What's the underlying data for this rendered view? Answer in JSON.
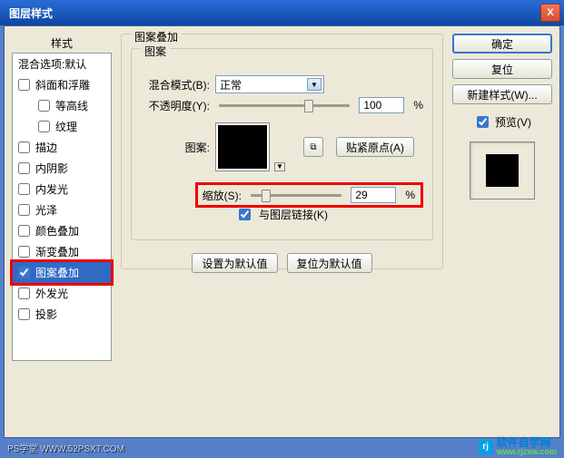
{
  "title": "图层样式",
  "close_x": "X",
  "left": {
    "header": "样式",
    "blendopts": "混合选项:默认",
    "items": [
      {
        "label": "斜面和浮雕",
        "checked": false,
        "indent": false
      },
      {
        "label": "等高线",
        "checked": false,
        "indent": true
      },
      {
        "label": "纹理",
        "checked": false,
        "indent": true
      },
      {
        "label": "描边",
        "checked": false,
        "indent": false
      },
      {
        "label": "内阴影",
        "checked": false,
        "indent": false
      },
      {
        "label": "内发光",
        "checked": false,
        "indent": false
      },
      {
        "label": "光泽",
        "checked": false,
        "indent": false
      },
      {
        "label": "颜色叠加",
        "checked": false,
        "indent": false
      },
      {
        "label": "渐变叠加",
        "checked": false,
        "indent": false
      },
      {
        "label": "图案叠加",
        "checked": true,
        "indent": false,
        "selected": true,
        "highlight": true
      },
      {
        "label": "外发光",
        "checked": false,
        "indent": false
      },
      {
        "label": "投影",
        "checked": false,
        "indent": false
      }
    ]
  },
  "center": {
    "outer_legend": "图案叠加",
    "inner_legend": "图案",
    "blendmode_label": "混合模式(B):",
    "blendmode_value": "正常",
    "opacity_label": "不透明度(Y):",
    "opacity_value": "100",
    "opacity_pct": "%",
    "pattern_label": "图案:",
    "snap_label": "贴紧原点(A)",
    "scale_label": "缩放(S):",
    "scale_value": "29",
    "scale_pct": "%",
    "link_label": "与图层链接(K)",
    "btn_default": "设置为默认值",
    "btn_reset": "复位为默认值"
  },
  "right": {
    "ok": "确定",
    "cancel": "复位",
    "newstyle": "新建样式(W)...",
    "preview": "预览(V)"
  },
  "footer": {
    "left": "PS学堂  WWW.52PSXT.COM",
    "right": "软件自学网",
    "url": "www.rjzxw.com",
    "logo": "rj"
  }
}
